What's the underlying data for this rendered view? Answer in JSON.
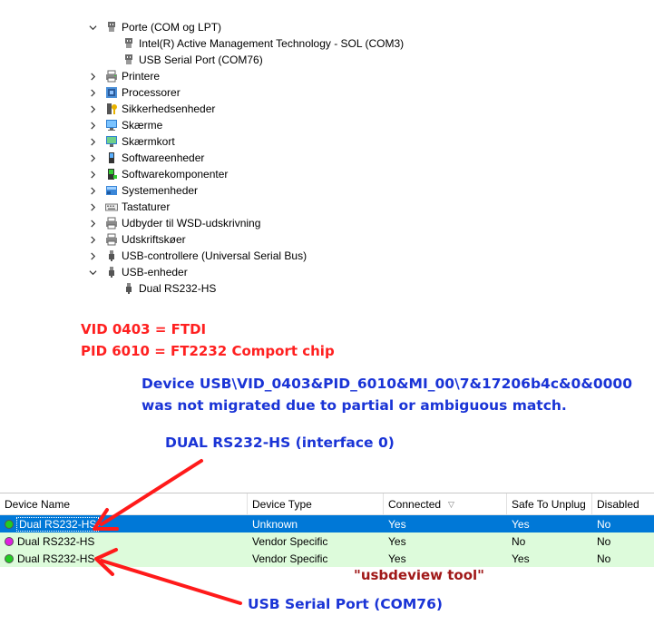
{
  "tree": {
    "items": [
      {
        "label": "Porte (COM og LPT)",
        "expanded": true,
        "level": 0,
        "icon": "port-icon"
      },
      {
        "label": "Intel(R) Active Management Technology - SOL (COM3)",
        "level": 1,
        "icon": "port-icon"
      },
      {
        "label": "USB Serial Port (COM76)",
        "level": 1,
        "icon": "port-icon"
      },
      {
        "label": "Printere",
        "expanded": false,
        "level": 0,
        "icon": "printer-icon"
      },
      {
        "label": "Processorer",
        "expanded": false,
        "level": 0,
        "icon": "processor-icon"
      },
      {
        "label": "Sikkerhedsenheder",
        "expanded": false,
        "level": 0,
        "icon": "security-key-icon"
      },
      {
        "label": "Skærme",
        "expanded": false,
        "level": 0,
        "icon": "monitor-icon"
      },
      {
        "label": "Skærmkort",
        "expanded": false,
        "level": 0,
        "icon": "display-adapter-icon"
      },
      {
        "label": "Softwareenheder",
        "expanded": false,
        "level": 0,
        "icon": "software-device-icon"
      },
      {
        "label": "Softwarekomponenter",
        "expanded": false,
        "level": 0,
        "icon": "software-component-icon"
      },
      {
        "label": "Systemenheder",
        "expanded": false,
        "level": 0,
        "icon": "system-device-icon"
      },
      {
        "label": "Tastaturer",
        "expanded": false,
        "level": 0,
        "icon": "keyboard-icon"
      },
      {
        "label": "Udbyder til WSD-udskrivning",
        "expanded": false,
        "level": 0,
        "icon": "printer-icon"
      },
      {
        "label": "Udskriftskøer",
        "expanded": false,
        "level": 0,
        "icon": "printer-icon"
      },
      {
        "label": "USB-controllere (Universal Serial Bus)",
        "expanded": false,
        "level": 0,
        "icon": "usb-icon"
      },
      {
        "label": "USB-enheder",
        "expanded": true,
        "level": 0,
        "icon": "usb-icon"
      },
      {
        "label": "Dual RS232-HS",
        "level": 1,
        "icon": "usb-icon"
      }
    ]
  },
  "annotations": {
    "vid": "VID 0403 = FTDI",
    "pid": "PID 6010 = FT2232 Comport chip",
    "device_line1": "Device USB\\VID_0403&PID_6010&MI_00\\7&17206b4c&0&0000",
    "device_line2": "was not migrated due to partial or ambiguous match.",
    "interface0": "DUAL RS232-HS (interface 0)",
    "tool": "\"usbdeview tool\"",
    "com76": "USB Serial Port (COM76)"
  },
  "table": {
    "columns": [
      "Device Name",
      "Device Type",
      "Connected",
      "Safe To Unplug",
      "Disabled"
    ],
    "rows": [
      {
        "name": "Dual RS232-HS",
        "type": "Unknown",
        "connected": "Yes",
        "safe": "Yes",
        "disabled": "No",
        "status_color": "#22cc22",
        "selected": true
      },
      {
        "name": "Dual RS232-HS",
        "type": "Vendor Specific",
        "connected": "Yes",
        "safe": "No",
        "disabled": "No",
        "status_color": "#e020e0",
        "selected": false
      },
      {
        "name": "Dual RS232-HS",
        "type": "Vendor Specific",
        "connected": "Yes",
        "safe": "Yes",
        "disabled": "No",
        "status_color": "#22cc22",
        "selected": false
      }
    ]
  },
  "colors": {
    "annotation_red": "#ff2020",
    "annotation_blue": "#1a34d6",
    "annotation_brown": "#a01818",
    "selection": "#0078d7",
    "row_green": "#ddfbdb",
    "arrow": "#ff1a1a"
  }
}
